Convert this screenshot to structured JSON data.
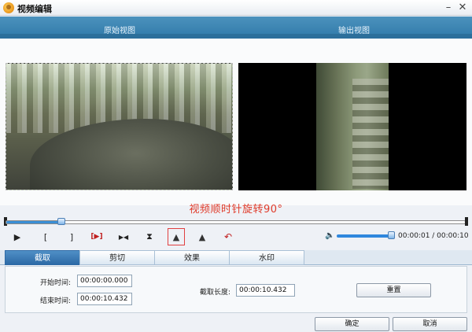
{
  "window": {
    "title": "视频编辑",
    "minimize": "–",
    "close": "✕"
  },
  "header": {
    "left_label": "原始视图",
    "right_label": "输出视图"
  },
  "status_message": "视频顺时针旋转90°",
  "timeline": {
    "progress_fraction": 0.12
  },
  "toolbar": {
    "buttons": [
      {
        "glyph": "▶"
      },
      {
        "glyph": "["
      },
      {
        "glyph": "]"
      },
      {
        "glyph": "[▶]"
      },
      {
        "glyph": "▶◀"
      },
      {
        "glyph": "⧗"
      },
      {
        "glyph": "▲"
      },
      {
        "glyph": "▲"
      },
      {
        "glyph": "↶"
      }
    ],
    "volume_fraction": 1.0,
    "time_readout": "00:00:01 / 00:00:10"
  },
  "tabs": [
    "截取",
    "剪切",
    "效果",
    "水印"
  ],
  "form": {
    "start_label": "开始时间:",
    "start_value": "00:00:00.000",
    "end_label": "结束时间:",
    "end_value": "00:00:10.432",
    "length_label": "截取长度:",
    "length_value": "00:00:10.432",
    "reset_label": "重置"
  },
  "footer": {
    "ok_label": "确定",
    "cancel_label": "取消"
  },
  "colors": {
    "accent": "#2f79a9",
    "status_red": "#e03b2a",
    "tab_active": "#2d6aa6"
  }
}
